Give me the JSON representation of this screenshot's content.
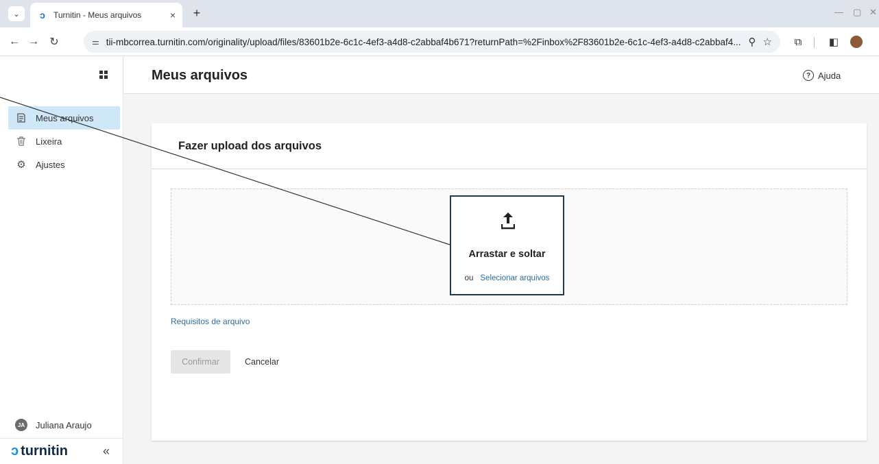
{
  "browser": {
    "tab_title": "Turnitin - Meus arquivos",
    "tab_close": "×",
    "new_tab": "+",
    "url": "tii-mbcorrea.turnitin.com/originality/upload/files/83601b2e-6c1c-4ef3-a4d8-c2abbaf4b671?returnPath=%2Finbox%2F83601b2e-6c1c-4ef3-a4d8-c2abbaf4..."
  },
  "sidebar": {
    "items": [
      {
        "label": "Meus arquivos",
        "icon": "files-icon",
        "active": true
      },
      {
        "label": "Lixeira",
        "icon": "trash-icon",
        "active": false
      },
      {
        "label": "Ajustes",
        "icon": "gear-icon",
        "active": false
      }
    ],
    "user": {
      "initials": "JA",
      "name": "Juliana Araujo"
    },
    "brand": "turnitin",
    "collapse_glyph": "«"
  },
  "header": {
    "title": "Meus arquivos",
    "help_label": "Ajuda",
    "help_glyph": "?"
  },
  "upload": {
    "card_title": "Fazer upload dos arquivos",
    "drag_text": "Arrastar e soltar",
    "or_text": "ou",
    "select_link": "Selecionar arquivos",
    "requirements_link": "Requisitos de arquivo",
    "confirm_label": "Confirmar",
    "cancel_label": "Cancelar"
  },
  "colors": {
    "accent": "#2b6ca3",
    "active_item": "#cfe8f8",
    "drop_border": "#1f3a4d",
    "brand_mark": "#1a8fd8"
  }
}
